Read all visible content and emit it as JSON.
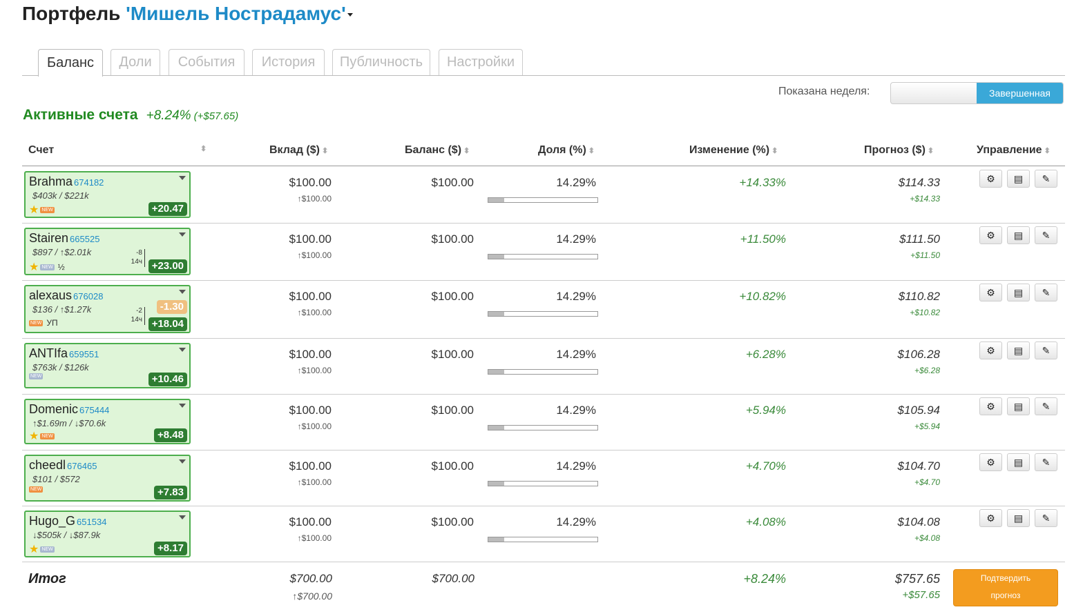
{
  "title": {
    "prefix": "Портфель",
    "name": "'Мишель Нострадамус'"
  },
  "tabs": [
    "Баланс",
    "Доли",
    "События",
    "История",
    "Публичность",
    "Настройки"
  ],
  "week": {
    "label": "Показана неделя:",
    "option": "Завершенная"
  },
  "section": {
    "title": "Активные счета",
    "change_pct": "+8.24%",
    "change_amt": "(+$57.65)"
  },
  "columns": [
    "Счет",
    "Вклад ($)",
    "Баланс ($)",
    "Доля (%)",
    "Изменение (%)",
    "Прогноз ($)",
    "Управление"
  ],
  "sort_glyph": "⬍",
  "buttons": {
    "settings_icon": "⚙",
    "list_icon": "▤",
    "edit_icon": "✎"
  },
  "accounts": [
    {
      "name": "Brahma",
      "id": "674182",
      "stats": "$403k / $221k",
      "star": true,
      "new_color": "orange",
      "extra": "",
      "badge": "+20.47",
      "badge2": "",
      "delta_top": "",
      "delta_bot": "",
      "deposit": "$100.00",
      "deposit_sub": "↑$100.00",
      "balance": "$100.00",
      "share": "14.29%",
      "share_fill": 0.1429,
      "change": "+14.33%",
      "forecast": "$114.33",
      "forecast_sub": "+$14.33"
    },
    {
      "name": "Stairen",
      "id": "665525",
      "stats": "$897 / ↑$2.01k",
      "star": true,
      "new_color": "grey",
      "extra": "½",
      "badge": "+23.00",
      "badge2": "",
      "delta_top": "-8",
      "delta_bot": "14ч",
      "deposit": "$100.00",
      "deposit_sub": "↑$100.00",
      "balance": "$100.00",
      "share": "14.29%",
      "share_fill": 0.1429,
      "change": "+11.50%",
      "forecast": "$111.50",
      "forecast_sub": "+$11.50"
    },
    {
      "name": "alexaus",
      "id": "676028",
      "stats": "$136 / ↑$1.27k",
      "star": false,
      "new_color": "orange",
      "extra": "УП",
      "badge": "+18.04",
      "badge2": "-1.30",
      "delta_top": "-2",
      "delta_bot": "14ч",
      "deposit": "$100.00",
      "deposit_sub": "↑$100.00",
      "balance": "$100.00",
      "share": "14.29%",
      "share_fill": 0.1429,
      "change": "+10.82%",
      "forecast": "$110.82",
      "forecast_sub": "+$10.82"
    },
    {
      "name": "ANTIfa",
      "id": "659551",
      "stats": "$763k / $126k",
      "star": false,
      "new_color": "grey",
      "extra": "",
      "badge": "+10.46",
      "badge2": "",
      "delta_top": "",
      "delta_bot": "",
      "deposit": "$100.00",
      "deposit_sub": "↑$100.00",
      "balance": "$100.00",
      "share": "14.29%",
      "share_fill": 0.1429,
      "change": "+6.28%",
      "forecast": "$106.28",
      "forecast_sub": "+$6.28"
    },
    {
      "name": "Domenic",
      "id": "675444",
      "stats": "↑$1.69m / ↓$70.6k",
      "star": true,
      "new_color": "orange",
      "extra": "",
      "badge": "+8.48",
      "badge2": "",
      "delta_top": "",
      "delta_bot": "",
      "deposit": "$100.00",
      "deposit_sub": "↑$100.00",
      "balance": "$100.00",
      "share": "14.29%",
      "share_fill": 0.1429,
      "change": "+5.94%",
      "forecast": "$105.94",
      "forecast_sub": "+$5.94"
    },
    {
      "name": "cheedl",
      "id": "676465",
      "stats": "$101 / $572",
      "star": false,
      "new_color": "orange",
      "extra": "",
      "badge": "+7.83",
      "badge2": "",
      "delta_top": "",
      "delta_bot": "",
      "deposit": "$100.00",
      "deposit_sub": "↑$100.00",
      "balance": "$100.00",
      "share": "14.29%",
      "share_fill": 0.1429,
      "change": "+4.70%",
      "forecast": "$104.70",
      "forecast_sub": "+$4.70"
    },
    {
      "name": "Hugo_G",
      "id": "651534",
      "stats": "↓$505k / ↓$87.9k",
      "star": true,
      "new_color": "grey",
      "extra": "",
      "badge": "+8.17",
      "badge2": "",
      "delta_top": "",
      "delta_bot": "",
      "deposit": "$100.00",
      "deposit_sub": "↑$100.00",
      "balance": "$100.00",
      "share": "14.29%",
      "share_fill": 0.1429,
      "change": "+4.08%",
      "forecast": "$104.08",
      "forecast_sub": "+$4.08"
    }
  ],
  "new_tag": "NEW",
  "totals": {
    "label": "Итог",
    "deposit": "$700.00",
    "deposit_sub": "↑$700.00",
    "balance": "$700.00",
    "change": "+8.24%",
    "forecast": "$757.65",
    "forecast_sub": "+$57.65"
  },
  "confirm_button": {
    "line1": "Подтвердить",
    "line2": "прогноз"
  }
}
